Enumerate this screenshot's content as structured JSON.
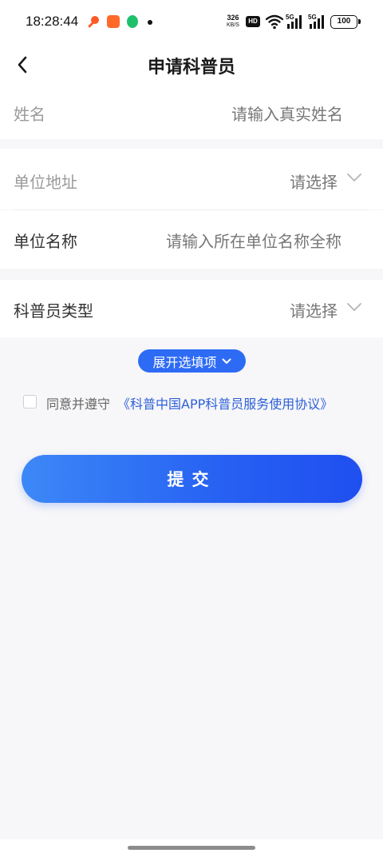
{
  "status_bar": {
    "time": "18:28:44",
    "net_speed_value": "326",
    "net_speed_unit": "KB/S",
    "hd_label": "HD",
    "signal_label_1": "5G",
    "signal_label_2": "5G",
    "battery": "100"
  },
  "nav": {
    "title": "申请科普员",
    "back_icon": "chevron-left-icon"
  },
  "form": {
    "name": {
      "label": "姓名",
      "placeholder": "请输入真实姓名"
    },
    "address": {
      "label": "单位地址",
      "value": "请选择"
    },
    "unit_name": {
      "label": "单位名称",
      "placeholder": "请输入所在单位名称全称"
    },
    "volunteer_type": {
      "label": "科普员类型",
      "value": "请选择"
    }
  },
  "expand": {
    "label": "展开选填项"
  },
  "agreement": {
    "text": "同意并遵守",
    "link": "《科普中国APP科普员服务使用协议》",
    "checked": false
  },
  "submit": {
    "label": "提交"
  },
  "colors": {
    "accent": "#2e6bf5",
    "link": "#2e5fd8",
    "background": "#f7f7f9"
  }
}
